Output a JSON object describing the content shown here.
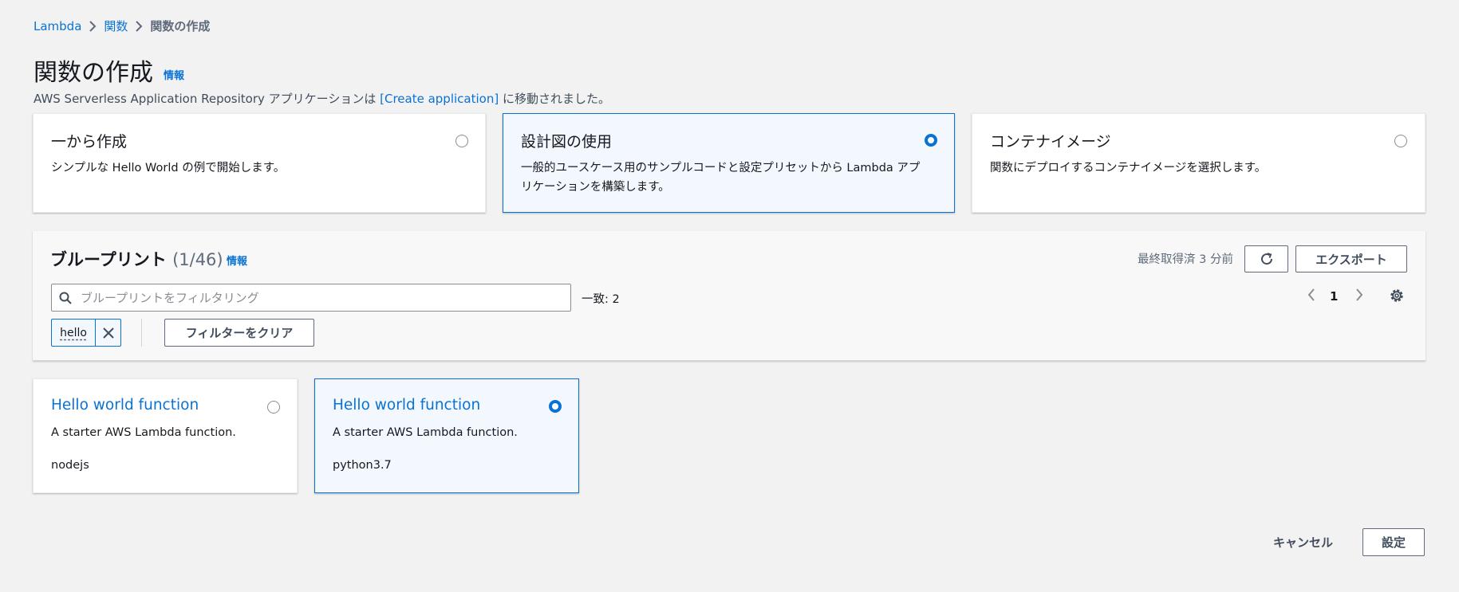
{
  "breadcrumb": [
    "Lambda",
    "関数",
    "関数の作成"
  ],
  "page": {
    "title": "関数の作成",
    "info": "情報",
    "notice_prefix": "AWS Serverless Application Repository アプリケーションは ",
    "notice_link": "[Create application]",
    "notice_suffix": " に移動されました。"
  },
  "options": [
    {
      "title": "一から作成",
      "desc": "シンプルな Hello World の例で開始します。",
      "selected": false
    },
    {
      "title": "設計図の使用",
      "desc": "一般的ユースケース用のサンプルコードと設定プリセットから Lambda アプリケーションを構築します。",
      "selected": true
    },
    {
      "title": "コンテナイメージ",
      "desc": "関数にデプロイするコンテナイメージを選択します。",
      "selected": false
    }
  ],
  "blueprints": {
    "title": "ブループリント",
    "count": "(1/46)",
    "info": "情報",
    "last_fetched": "最終取得済 3 分前",
    "export_label": "エクスポート",
    "search_placeholder": "ブループリントをフィルタリング",
    "match_count": "一致: 2",
    "page_number": "1",
    "filter_token": "hello",
    "clear_filter_label": "フィルターをクリア"
  },
  "results": [
    {
      "title": "Hello world function",
      "desc": "A starter AWS Lambda function.",
      "runtime": "nodejs",
      "selected": false
    },
    {
      "title": "Hello world function",
      "desc": "A starter AWS Lambda function.",
      "runtime": "python3.7",
      "selected": true
    }
  ],
  "footer": {
    "cancel_label": "キャンセル",
    "submit_label": "設定"
  },
  "colors": {
    "accent": "#0972d3",
    "selected_bg": "#f2f8fd",
    "page_bg": "#f2f2f2"
  }
}
